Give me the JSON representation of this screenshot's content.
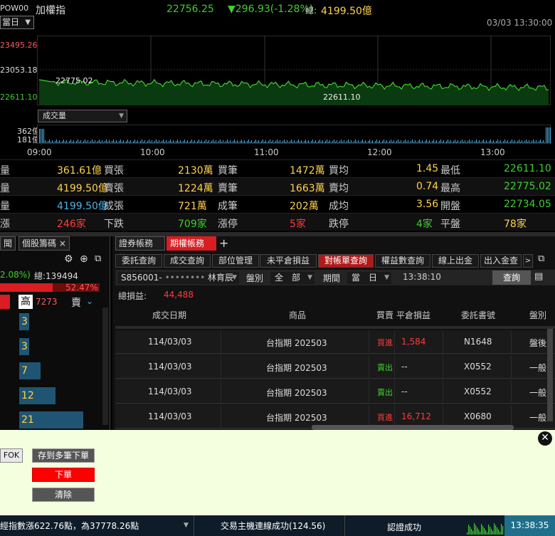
{
  "header": {
    "symbol": "POW00",
    "name": "加權指",
    "price": "22756.25",
    "change": "▼296.93(-1.28%)",
    "total_label": "總:",
    "total_value": "4199.50億",
    "datetime": "03/03  13:30:00",
    "range_select": "當日"
  },
  "chart": {
    "y_high": "23495.26",
    "y_mid": "23053.18",
    "y_low": "22611.10",
    "label_high_point": "22775.02",
    "label_low_point": "22611.10",
    "volume_select": "成交量",
    "vol_max": "362億",
    "vol_mid": "181億",
    "times": [
      "09:00",
      "10:00",
      "11:00",
      "12:00",
      "13:00"
    ],
    "line_color": "#3ecf2e",
    "fill_color": "#0a3a10"
  },
  "quotes": [
    [
      {
        "t": "量",
        "c": "#ccc"
      },
      {
        "t": "361.61億",
        "c": "#ffd24a"
      },
      {
        "t": "買張",
        "c": "#ccc"
      },
      {
        "t": "2130萬",
        "c": "#ffd24a"
      },
      {
        "t": "買筆",
        "c": "#ccc"
      },
      {
        "t": "1472萬",
        "c": "#ffd24a"
      },
      {
        "t": "買均",
        "c": "#ccc"
      },
      {
        "t": "1.45",
        "c": "#ffd24a"
      },
      {
        "t": "最低",
        "c": "#ccc"
      },
      {
        "t": "22611.10",
        "c": "#3ecf2e"
      }
    ],
    [
      {
        "t": "量",
        "c": "#ccc"
      },
      {
        "t": "4199.50億",
        "c": "#ffd24a"
      },
      {
        "t": "賣張",
        "c": "#ccc"
      },
      {
        "t": "1224萬",
        "c": "#ffd24a"
      },
      {
        "t": "賣筆",
        "c": "#ccc"
      },
      {
        "t": "1663萬",
        "c": "#ffd24a"
      },
      {
        "t": "賣均",
        "c": "#ccc"
      },
      {
        "t": "0.74",
        "c": "#ffd24a"
      },
      {
        "t": "最高",
        "c": "#ccc"
      },
      {
        "t": "22775.02",
        "c": "#3ecf2e"
      }
    ],
    [
      {
        "t": "量",
        "c": "#ccc"
      },
      {
        "t": "4199.50億",
        "c": "#4fb3e8"
      },
      {
        "t": "成張",
        "c": "#ccc"
      },
      {
        "t": "721萬",
        "c": "#ffd24a"
      },
      {
        "t": "成筆",
        "c": "#ccc"
      },
      {
        "t": "202萬",
        "c": "#ffd24a"
      },
      {
        "t": "成均",
        "c": "#ccc"
      },
      {
        "t": "3.56",
        "c": "#ffd24a"
      },
      {
        "t": "開盤",
        "c": "#ccc"
      },
      {
        "t": "22734.05",
        "c": "#3ecf2e"
      }
    ],
    [
      {
        "t": "漲",
        "c": "#ccc"
      },
      {
        "t": "246家",
        "c": "#ff3b3b"
      },
      {
        "t": "下跌",
        "c": "#ccc"
      },
      {
        "t": "709家",
        "c": "#3ecf2e"
      },
      {
        "t": "漲停",
        "c": "#ccc"
      },
      {
        "t": "5家",
        "c": "#ff3b3b"
      },
      {
        "t": "跌停",
        "c": "#ccc"
      },
      {
        "t": "4家",
        "c": "#3ecf2e"
      },
      {
        "t": "平盤",
        "c": "#ccc"
      },
      {
        "t": "78家",
        "c": "#ffd24a"
      }
    ]
  ],
  "left_panel": {
    "tabs": [
      "聞",
      "個股籌碼"
    ],
    "pct": "2.08%)",
    "total": "總:139494",
    "red_pct": "52.47%",
    "high_label": "高",
    "high_value": "7273",
    "sell_label": "賣",
    "items": [
      "3",
      "3",
      "7",
      "12",
      "21"
    ]
  },
  "account": {
    "tabs": [
      "證券帳務",
      "期權帳務"
    ],
    "sub_tabs": [
      "委託查詢",
      "成交查詢",
      "部位管理",
      "未平倉損益",
      "對帳單查詢",
      "權益數查詢",
      "線上出金",
      "出入金查"
    ],
    "account_no": "S856001-",
    "account_name": "林育辰",
    "filter_label": "盤別",
    "filter_value": "全　部",
    "period_label": "期間",
    "period_value": "當　日",
    "time": "13:38:10",
    "query_btn": "查詢",
    "total_pl_label": "總損益:",
    "total_pl": "44,488",
    "columns": [
      "成交日期",
      "商品",
      "買賣",
      "平倉損益",
      "委託書號",
      "盤別"
    ],
    "rows": [
      {
        "date": "114/03/03",
        "product": "台指期 202503",
        "side": "買進",
        "side_color": "#ff3b3b",
        "pl": "1,584",
        "pl_color": "#ff3b3b",
        "order": "N1648",
        "session": "盤後"
      },
      {
        "date": "114/03/03",
        "product": "台指期 202503",
        "side": "賣出",
        "side_color": "#3ecf2e",
        "pl": "--",
        "pl_color": "#ddd",
        "order": "X0552",
        "session": "一般"
      },
      {
        "date": "114/03/03",
        "product": "台指期 202503",
        "side": "賣出",
        "side_color": "#3ecf2e",
        "pl": "--",
        "pl_color": "#ddd",
        "order": "X0552",
        "session": "一般"
      },
      {
        "date": "114/03/03",
        "product": "台指期 202503",
        "side": "買進",
        "side_color": "#ff3b3b",
        "pl": "16,712",
        "pl_color": "#ff3b3b",
        "order": "X0680",
        "session": "一般"
      }
    ]
  },
  "order": {
    "fok": "FOK",
    "save_multi": "存到多筆下單",
    "submit": "下單",
    "clear": "清除"
  },
  "status": {
    "ticker": "經指數漲622.76點，為37778.26點",
    "connection": "交易主機連線成功(124.56)",
    "auth": "認證成功",
    "time": "13:38:35"
  }
}
